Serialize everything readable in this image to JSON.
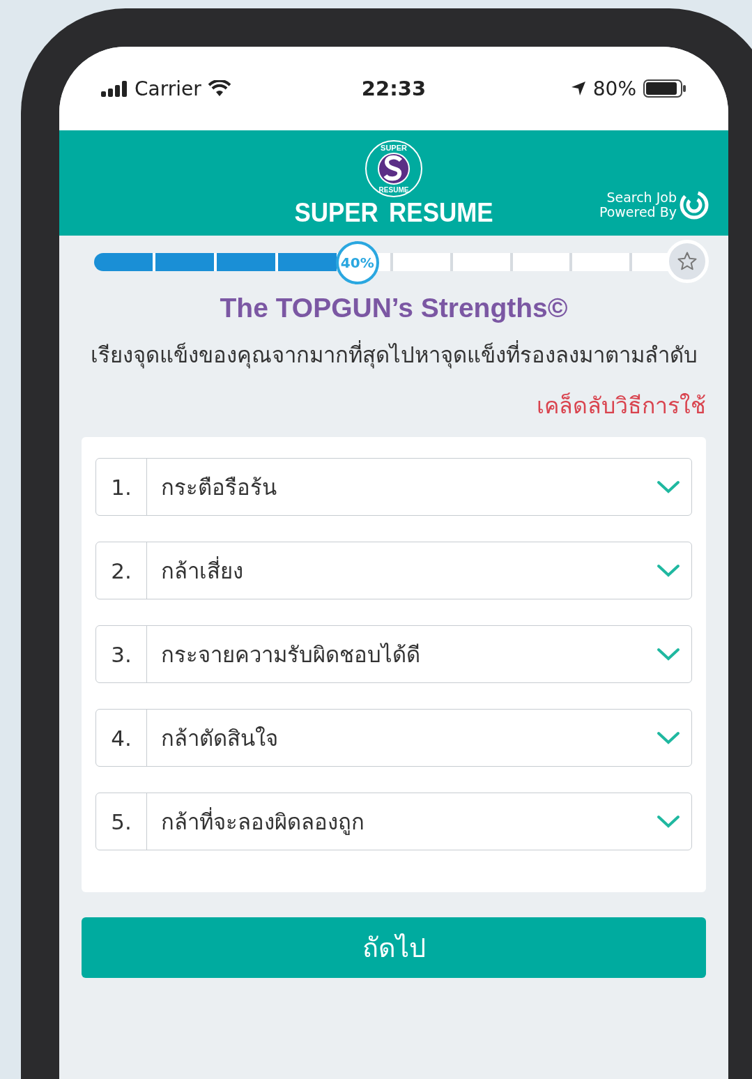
{
  "status_bar": {
    "carrier": "Carrier",
    "time": "22:33",
    "battery": "80%"
  },
  "header": {
    "logo_top": "SUPER",
    "logo_bottom": "RESUME",
    "title": "SUPER RESUME",
    "partner_line_1": "Search Job",
    "partner_line_2": "Powered By"
  },
  "progress": {
    "level": 0.4,
    "reading": "40%"
  },
  "title": "The TOPGUN’s Strengths©",
  "instruction": "เรียงจุดแข็งของคุณจากมากที่สุดไปหาจุดแข็งที่รองลงมาตามลำดับ",
  "tip_link": "เคล็ดลับวิธีการใช้",
  "items": [
    {
      "number": "1.",
      "value": "กระตือรือร้น"
    },
    {
      "number": "2.",
      "value": "กล้าเสี่ยง"
    },
    {
      "number": "3.",
      "value": "กระจายความรับผิดชอบได้ดี"
    },
    {
      "number": "4.",
      "value": "กล้าตัดสินใจ"
    },
    {
      "number": "5.",
      "value": "กล้าที่จะลองผิดลองถูก"
    }
  ],
  "next_button": "ถัดไป"
}
